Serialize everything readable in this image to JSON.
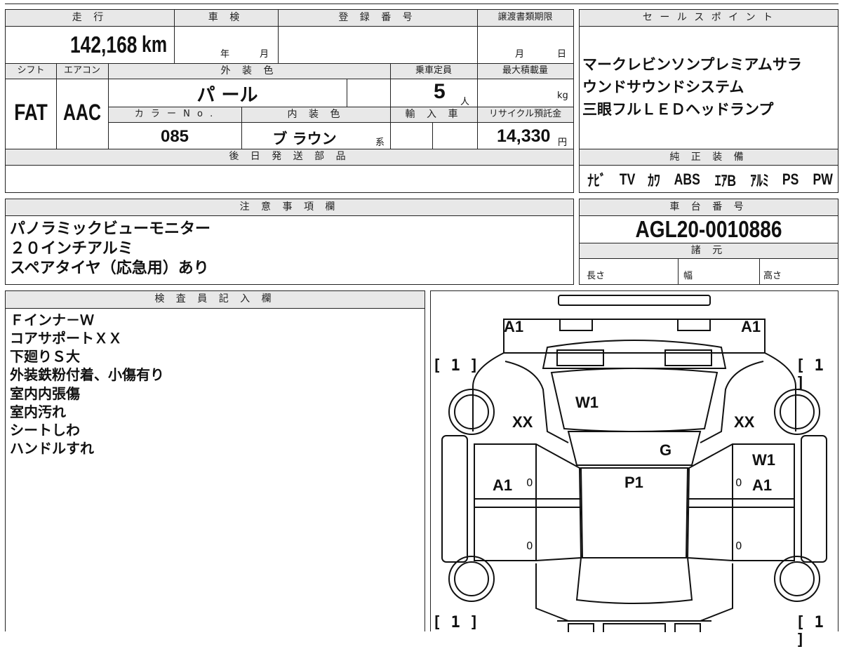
{
  "main_table": {
    "mileage_label": "走 行",
    "mileage_value": "142,168",
    "mileage_unit": "km",
    "shaken_label": "車 検",
    "shaken_year": "年",
    "shaken_month": "月",
    "reg_label": "登 録 番 号",
    "transfer_label": "譲渡書類期限",
    "transfer_month": "月",
    "transfer_day": "日",
    "shift_label": "シフト",
    "aircon_label": "エアコン",
    "exterior_color_label": "外 装 色",
    "capacity_label": "乗車定員",
    "max_load_label": "最大積載量",
    "shift_value": "FAT",
    "aircon_value": "AAC",
    "exterior_color_value": "パ ール",
    "capacity_value": "5",
    "capacity_unit": "人",
    "load_unit": "kg",
    "color_no_label": "カ ラ ー N o .",
    "interior_color_label": "内 装 色",
    "import_label": "輸 入 車",
    "recycle_label": "リサイクル預託金",
    "color_no_value": "085",
    "interior_color_value": "ブ ラウン",
    "interior_suffix": "系",
    "recycle_value": "14,330",
    "recycle_unit": "円",
    "later_parts_label": "後 日 発 送 部 品"
  },
  "sales_point": {
    "header": "セ ー ル ス ポ イ ン ト",
    "lines": [
      "マークレビンソンプレミアムサラ",
      "ウンドサウンドシステム",
      "三眼フルＬＥＤヘッドランプ"
    ]
  },
  "genuine_equipment": {
    "header": "純 正 装 備",
    "items": [
      "ﾅﾋﾞ",
      "TV",
      "ｶﾜ",
      "ABS",
      "ｴｱB",
      "ｱﾙﾐ",
      "PS",
      "PW"
    ]
  },
  "notes": {
    "header": "注 意 事 項 欄",
    "lines": [
      "パノラミックビューモニター",
      "２０インチアルミ",
      "スペアタイヤ（応急用）あり"
    ]
  },
  "chassis": {
    "header": "車 台 番 号",
    "value": "AGL20-0010886",
    "spec_header": "諸 元",
    "length_label": "長さ",
    "width_label": "幅",
    "height_label": "高さ"
  },
  "inspector": {
    "header": "検 査 員 記 入 欄",
    "lines": [
      "Ｆインナ－Ｗ",
      "コアサポートＸＸ",
      "下廻りＳ大",
      "外装鉄粉付着、小傷有り",
      "室内内張傷",
      "室内汚れ",
      "シートしわ",
      "ハンドルすれ"
    ]
  },
  "diagram": {
    "marks": {
      "front_left": "A1",
      "front_right": "A1",
      "windshield": "W1",
      "fender_left": "XX",
      "fender_right": "XX",
      "hood_g": "G",
      "door_right_w": "W1",
      "door_left": "A1",
      "roof": "P1",
      "door_right": "A1",
      "zero": "0"
    },
    "tire_brackets": [
      "[ 1 ]",
      "[ 1 ]",
      "[ 1 ]",
      "[ 1 ]"
    ]
  }
}
